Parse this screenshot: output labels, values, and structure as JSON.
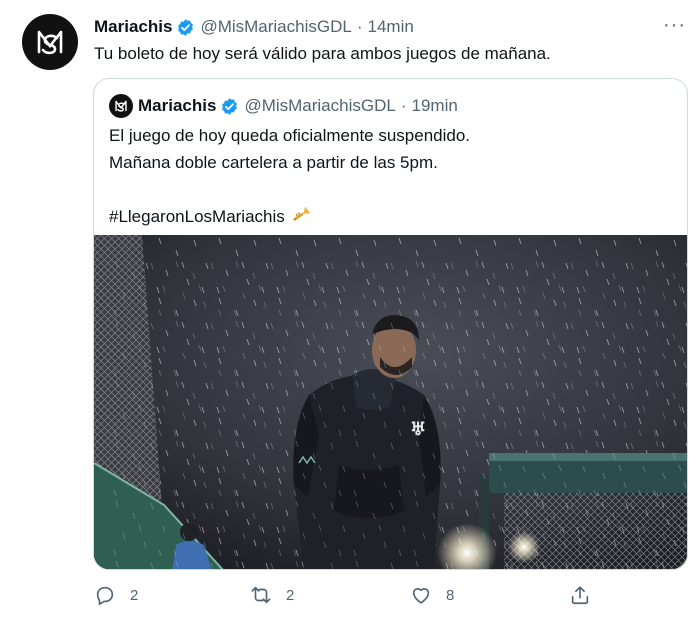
{
  "tweet": {
    "author": {
      "name": "Mariachis",
      "handle": "@MisMariachisGDL",
      "verified": true,
      "avatar_icon": "mariachis-logo-icon"
    },
    "separator": "·",
    "time": "14min",
    "text": "Tu boleto de hoy será válido para ambos juegos de mañana.",
    "more_icon": "more-dots-icon",
    "more_label": "···"
  },
  "quoted_tweet": {
    "author": {
      "name": "Mariachis",
      "handle": "@MisMariachisGDL",
      "verified": true
    },
    "separator": "·",
    "time": "19min",
    "lines": [
      "El juego de hoy queda oficialmente suspendido.",
      "Mañana doble cartelera a partir de las 5pm.",
      "",
      "#LlegaronLosMariachis"
    ],
    "emoji": "trumpet-icon",
    "image_icon": "photo-rainy-ballpark-manager"
  },
  "actions": {
    "reply": {
      "icon": "reply-icon",
      "count": "2"
    },
    "retweet": {
      "icon": "retweet-icon",
      "count": "2"
    },
    "like": {
      "icon": "heart-icon",
      "count": "8"
    },
    "share": {
      "icon": "share-icon"
    }
  },
  "colors": {
    "text": "#0f1419",
    "secondary": "#536471",
    "verified": "#1d9bf0",
    "border": "#cfd9de"
  }
}
